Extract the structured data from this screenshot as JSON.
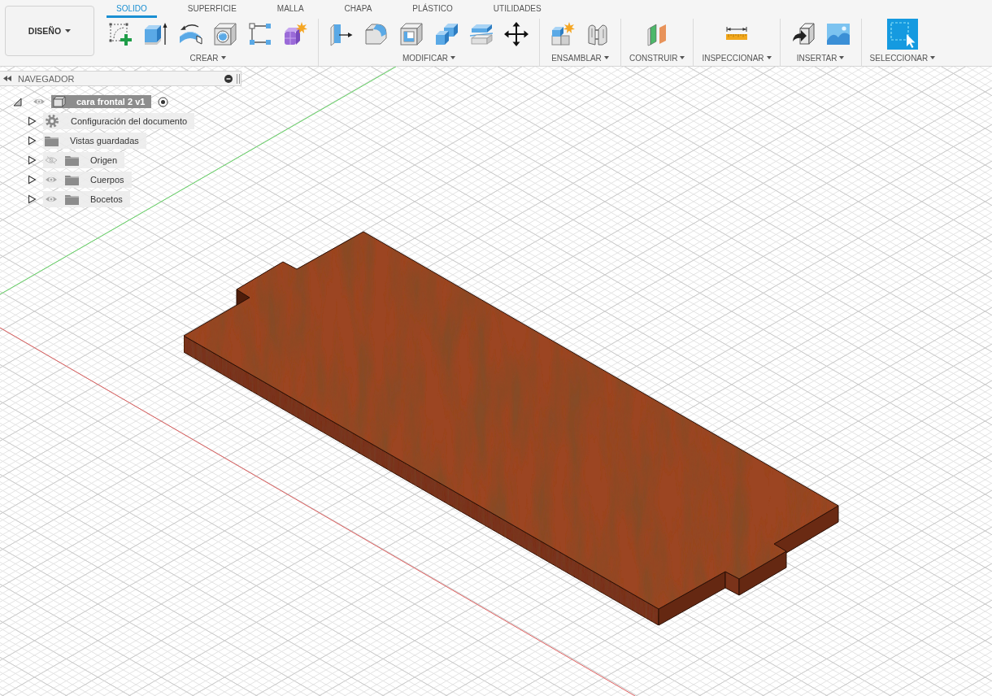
{
  "workspace_button": {
    "label": "DISEÑO"
  },
  "tabs": [
    {
      "label": "SOLIDO",
      "selected": true
    },
    {
      "label": "SUPERFICIE",
      "selected": false
    },
    {
      "label": "MALLA",
      "selected": false
    },
    {
      "label": "CHAPA",
      "selected": false
    },
    {
      "label": "PLÁSTICO",
      "selected": false
    },
    {
      "label": "UTILIDADES",
      "selected": false
    }
  ],
  "tool_groups": [
    {
      "label": "CREAR",
      "tools": [
        {
          "kind": "sketch"
        },
        {
          "kind": "extrude"
        },
        {
          "kind": "revolve"
        },
        {
          "kind": "hole"
        },
        {
          "kind": "pattern"
        },
        {
          "kind": "form"
        }
      ]
    },
    {
      "label": "MODIFICAR",
      "tools": [
        {
          "kind": "presspull"
        },
        {
          "kind": "fillet"
        },
        {
          "kind": "shell"
        },
        {
          "kind": "combine"
        },
        {
          "kind": "split"
        },
        {
          "kind": "move"
        }
      ]
    },
    {
      "label": "ENSAMBLAR",
      "tools": [
        {
          "kind": "component"
        },
        {
          "kind": "joint"
        }
      ]
    },
    {
      "label": "CONSTRUIR",
      "tools": [
        {
          "kind": "plane"
        }
      ]
    },
    {
      "label": "INSPECCIONAR",
      "tools": [
        {
          "kind": "measure"
        }
      ]
    },
    {
      "label": "INSERTAR",
      "tools": [
        {
          "kind": "derive"
        },
        {
          "kind": "canvas"
        }
      ]
    },
    {
      "label": "SELECCIONAR",
      "tools": [
        {
          "kind": "select"
        }
      ]
    }
  ],
  "navigator": {
    "title": "NAVEGADOR",
    "root": {
      "label": "cara frontal 2 v1",
      "expanded": true,
      "visible": true,
      "active": true,
      "children": [
        {
          "label": "Configuración del documento",
          "kind": "settings",
          "expanded": false
        },
        {
          "label": "Vistas guardadas",
          "kind": "folder",
          "expanded": false
        },
        {
          "label": "Origen",
          "kind": "folder",
          "expanded": false,
          "visible": false
        },
        {
          "label": "Cuerpos",
          "kind": "folder",
          "expanded": false,
          "visible": true
        },
        {
          "label": "Bocetos",
          "kind": "folder",
          "expanded": false,
          "visible": true
        }
      ]
    }
  }
}
